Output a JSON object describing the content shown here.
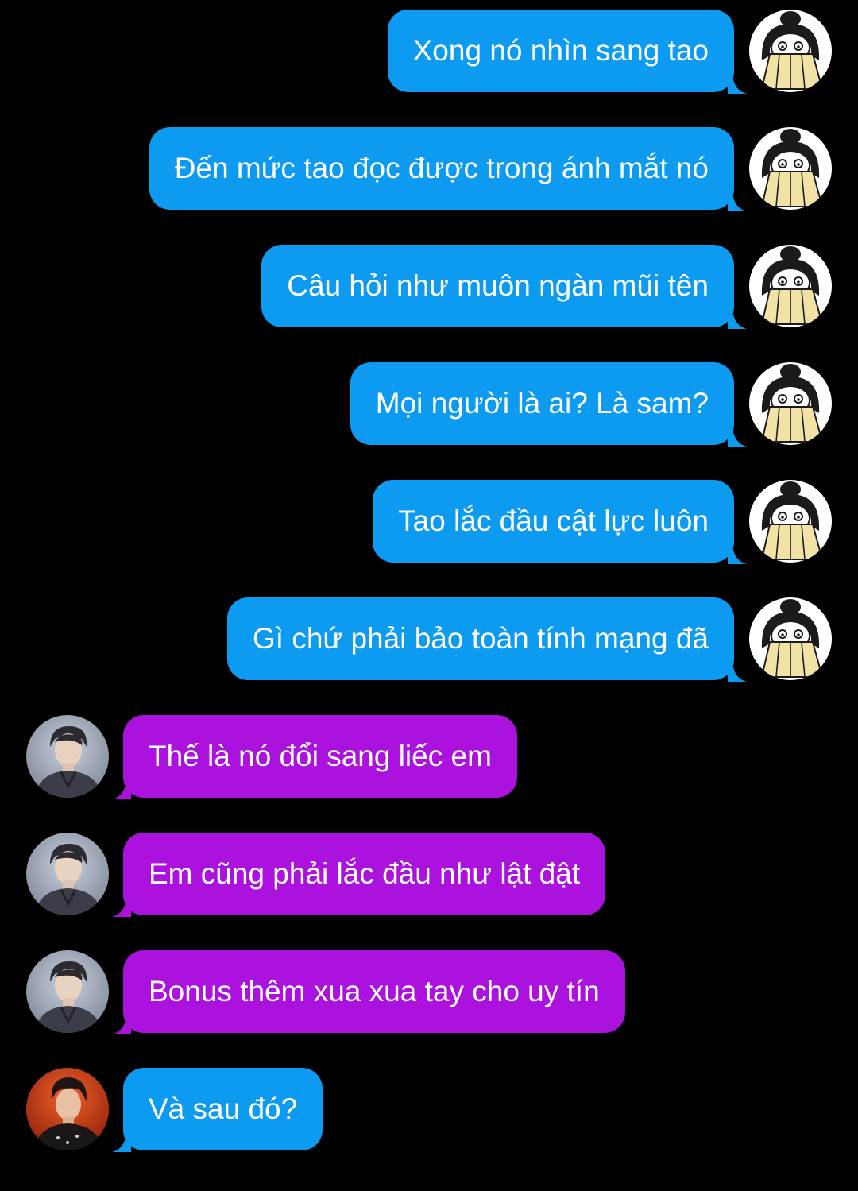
{
  "colors": {
    "background": "#000000",
    "outgoing_bubble": "#0c9bf0",
    "incoming_bubble": "#ac12dd",
    "text": "#ffffff"
  },
  "messages": [
    {
      "text": "Xong nó nhìn sang tao",
      "side": "right",
      "bubble_color": "blue",
      "avatar": "anime-fan-avatar"
    },
    {
      "text": "Đến mức tao đọc được trong ánh mắt nó",
      "side": "right",
      "bubble_color": "blue",
      "avatar": "anime-fan-avatar"
    },
    {
      "text": "Câu hỏi như muôn ngàn mũi tên",
      "side": "right",
      "bubble_color": "blue",
      "avatar": "anime-fan-avatar"
    },
    {
      "text": "Mọi người là ai? Là sam?",
      "side": "right",
      "bubble_color": "blue",
      "avatar": "anime-fan-avatar"
    },
    {
      "text": "Tao lắc đầu cật lực luôn",
      "side": "right",
      "bubble_color": "blue",
      "avatar": "anime-fan-avatar"
    },
    {
      "text": "Gì chứ phải bảo toàn tính mạng đã",
      "side": "right",
      "bubble_color": "blue",
      "avatar": "anime-fan-avatar"
    },
    {
      "text": "Thế là nó đổi sang liếc em",
      "side": "left",
      "bubble_color": "purple",
      "avatar": "man-portrait-avatar"
    },
    {
      "text": "Em cũng phải lắc đầu như lật đật",
      "side": "left",
      "bubble_color": "purple",
      "avatar": "man-portrait-avatar"
    },
    {
      "text": "Bonus thêm xua xua tay cho uy tín",
      "side": "left",
      "bubble_color": "purple",
      "avatar": "man-portrait-avatar"
    },
    {
      "text": "Và sau đó?",
      "side": "left",
      "bubble_color": "blue",
      "avatar": "man-red-portrait-avatar"
    }
  ]
}
